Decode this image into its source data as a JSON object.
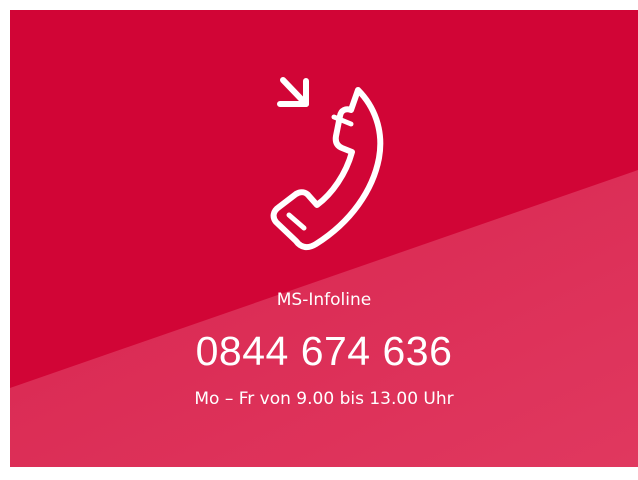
{
  "infoline": {
    "label": "MS-Infoline",
    "phone_number": "0844 674 636",
    "hours": "Mo – Fr von 9.00 bis 13.00 Uhr",
    "icon": "incoming-call-icon"
  },
  "colors": {
    "primary_red": "#d10536",
    "light_red": "#dc2b55",
    "text": "#ffffff"
  }
}
